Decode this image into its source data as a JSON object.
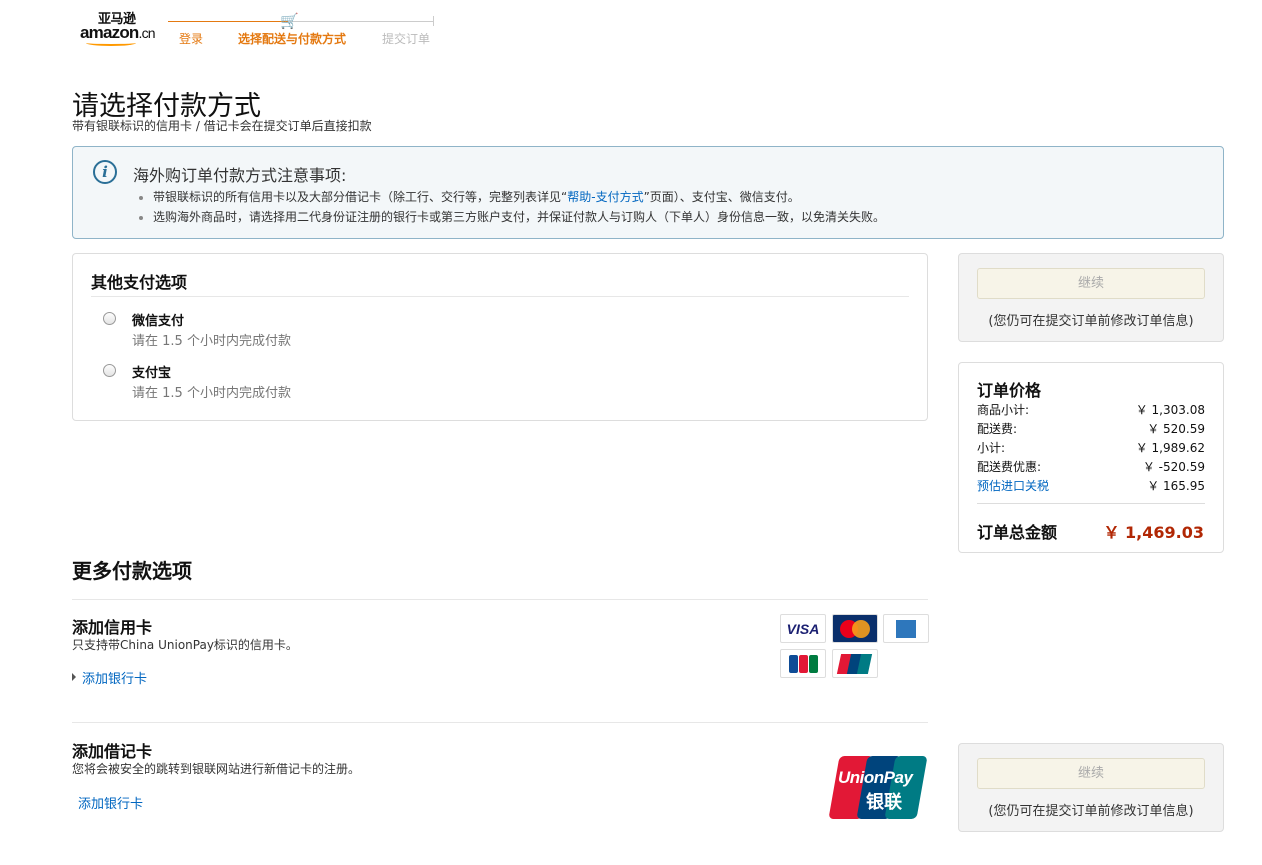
{
  "header": {
    "logo_cn": "亚马逊",
    "logo_en": "amazon",
    "logo_suffix": ".cn",
    "steps": [
      "登录",
      "选择配送与付款方式",
      "提交订单"
    ]
  },
  "page": {
    "title": "请选择付款方式",
    "subtitle": "带有银联标识的信用卡 / 借记卡会在提交订单后直接扣款"
  },
  "notice": {
    "title": "海外购订单付款方式注意事项:",
    "bullet1_pre": "带银联标识的所有信用卡以及大部分借记卡（除工行、交行等，完整列表详见“",
    "bullet1_link": "帮助-支付方式",
    "bullet1_post": "”页面）、支付宝、微信支付。",
    "bullet2": "选购海外商品时，请选择用二代身份证注册的银行卡或第三方账户支付，并保证付款人与订购人（下单人）身份信息一致，以免清关失败。"
  },
  "other_options": {
    "title": "其他支付选项",
    "options": [
      {
        "name": "微信支付",
        "desc": "请在 1.5 个小时内完成付款"
      },
      {
        "name": "支付宝",
        "desc": "请在 1.5 个小时内完成付款"
      }
    ]
  },
  "continue_box": {
    "button": "继续",
    "note": "(您仍可在提交订单前修改订单信息)"
  },
  "summary": {
    "title": "订单价格",
    "rows": [
      {
        "label": "商品小计:",
        "value": "￥ 1,303.08"
      },
      {
        "label": "配送费:",
        "value": "￥ 520.59"
      },
      {
        "label": "小计:",
        "value": "￥ 1,989.62"
      },
      {
        "label": "配送费优惠:",
        "value": "￥ -520.59"
      },
      {
        "label": "预估进口关税",
        "value": "￥ 165.95"
      }
    ],
    "total_label": "订单总金额",
    "total_value": "￥ 1,469.03",
    "total_color": "#b12704"
  },
  "more": {
    "title": "更多付款选项",
    "credit": {
      "title": "添加信用卡",
      "desc": "只支持带China UnionPay标识的信用卡。",
      "link": "添加银行卡",
      "cards": {
        "visa": "VISA",
        "mastercard": "MasterCard",
        "jcb": "JCB",
        "unionpay_small": "UnionPay"
      }
    },
    "debit": {
      "title": "添加借记卡",
      "desc": "您将会被安全的跳转到银联网站进行新借记卡的注册。",
      "link": "添加银行卡",
      "logo_en": "UnionPay",
      "logo_cn": "银联"
    }
  }
}
